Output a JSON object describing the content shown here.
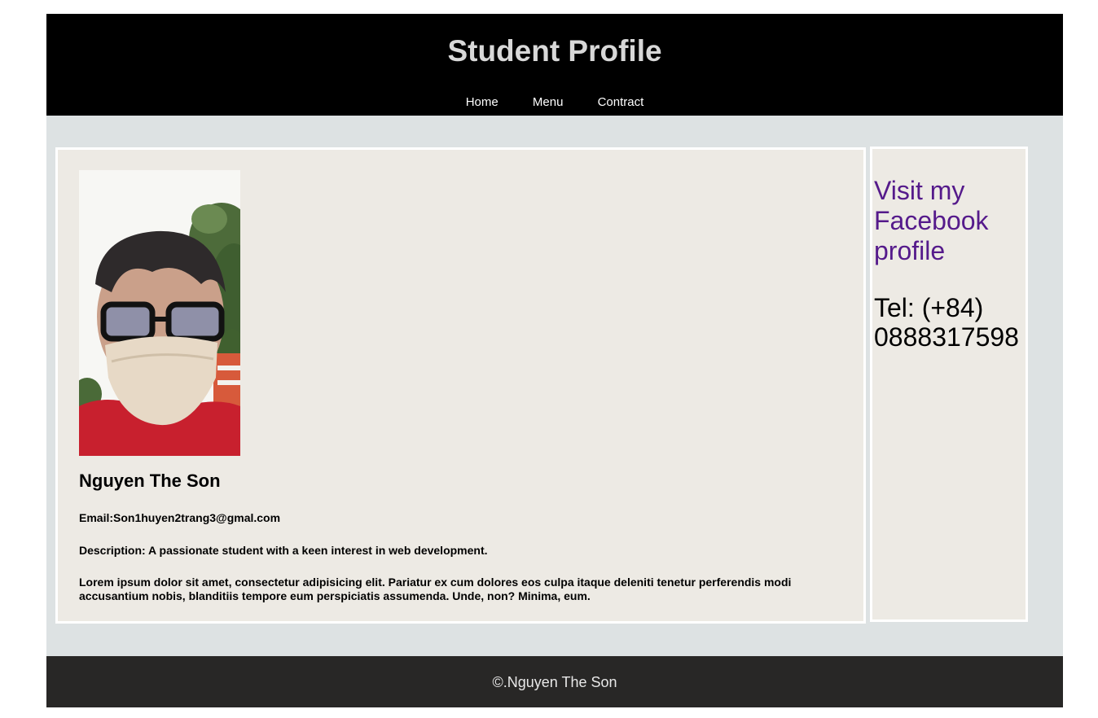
{
  "header": {
    "title": "Student Profile",
    "nav": [
      {
        "label": "Home"
      },
      {
        "label": "Menu"
      },
      {
        "label": "Contract"
      }
    ]
  },
  "profile": {
    "name": "Nguyen The Son",
    "email": "Email:Son1huyen2trang3@gmal.com",
    "description": "Description: A passionate student with a keen interest in web development.",
    "bio": "Lorem ipsum dolor sit amet, consectetur adipisicing elit. Pariatur ex cum dolores eos culpa itaque deleniti tenetur perferendis modi accusantium nobis, blanditiis tempore eum perspiciatis assumenda. Unde, non? Minima, eum."
  },
  "sidebar": {
    "facebook_link": "Visit my Facebook profile",
    "tel": "Tel: (+84) 0888317598"
  },
  "footer": {
    "text": "©.Nguyen The Son"
  },
  "colors": {
    "header_bg": "#000000",
    "content_bg": "#dde2e3",
    "card_bg": "#edeae4",
    "footer_bg": "#282726",
    "link": "#551a8b"
  }
}
